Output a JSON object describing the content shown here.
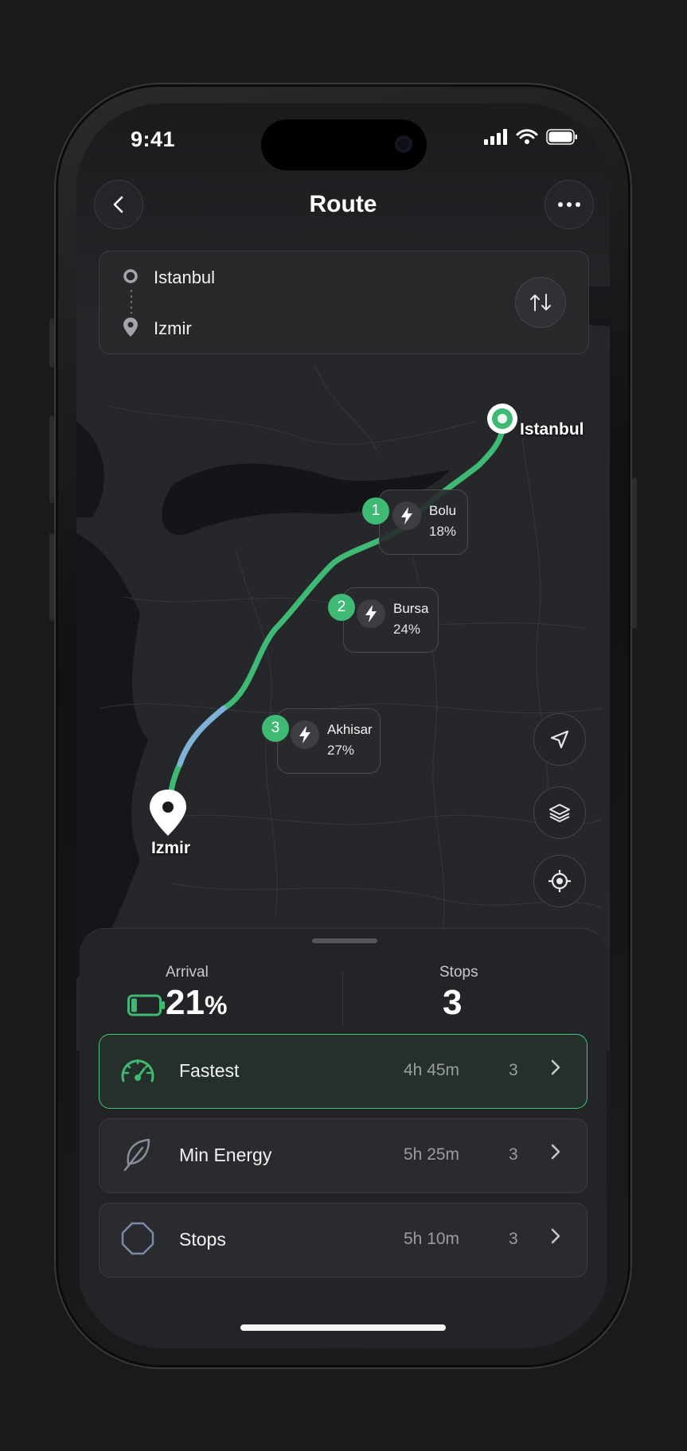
{
  "status_bar": {
    "time": "9:41"
  },
  "header": {
    "title": "Route"
  },
  "route_card": {
    "origin": "Istanbul",
    "destination": "Izmir"
  },
  "map": {
    "origin_label": "Istanbul",
    "destination_label": "Izmir",
    "stops": [
      {
        "number": "1",
        "name": "Bolu",
        "charge": "18%"
      },
      {
        "number": "2",
        "name": "Bursa",
        "charge": "24%"
      },
      {
        "number": "3",
        "name": "Akhisar",
        "charge": "27%"
      }
    ],
    "controls": [
      "navigate-icon",
      "layers-icon",
      "locate-icon"
    ]
  },
  "summary": {
    "arrival_label": "Arrival",
    "arrival_value": "21",
    "arrival_unit": "%",
    "battery_level": 0.21,
    "stops_label": "Stops",
    "stops_value": "3"
  },
  "options": [
    {
      "label": "Fastest",
      "time": "4h 45m",
      "stops": "3",
      "icon": "speedometer-icon",
      "selected": true
    },
    {
      "label": "Min Energy",
      "time": "5h 25m",
      "stops": "3",
      "icon": "leaf-icon",
      "selected": false
    },
    {
      "label": "Stops",
      "time": "5h 10m",
      "stops": "3",
      "icon": "octagon-icon",
      "selected": false
    }
  ],
  "colors": {
    "accent": "#3fba74",
    "route_alt": "#7fb2d8",
    "background": "#1a1b1d",
    "sheet": "#232427"
  }
}
